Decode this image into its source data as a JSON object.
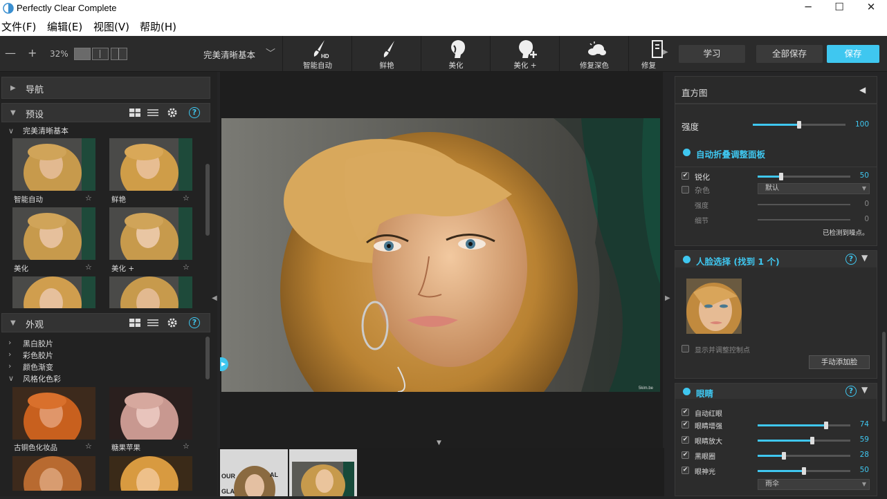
{
  "window": {
    "title": "Perfectly Clear Complete"
  },
  "menu": [
    "文件(F)",
    "编辑(E)",
    "视图(V)",
    "帮助(H)"
  ],
  "toolbar": {
    "zoom_out": "—",
    "zoom_in": "+",
    "zoom": "32%",
    "preset_selected": "完美清晰基本",
    "tools": [
      "智能自动",
      "鲜艳",
      "美化",
      "美化 +",
      "修复深色",
      "修复"
    ],
    "learn_label": "学习",
    "save_all_label": "全部保存",
    "save_label": "保存"
  },
  "left": {
    "nav_title": "导航",
    "presets_title": "预设",
    "presets_group": "完美清晰基本",
    "preset_items": [
      "智能自动",
      "鲜艳",
      "美化",
      "美化 +"
    ],
    "looks_title": "外观",
    "looks_groups": [
      "黑白胶片",
      "彩色胶片",
      "颜色渐变",
      "风格化色彩"
    ],
    "look_items": [
      "古铜色化妆品",
      "糖果苹果"
    ]
  },
  "right": {
    "histogram_title": "直方图",
    "strength_label": "强度",
    "strength_value": 100,
    "auto_collapse_label": "自动折叠调整面板",
    "sharpen_label": "锐化",
    "sharpen_value": 50,
    "noise_label": "杂色",
    "noise_select": "默认",
    "noise_strength_label": "强度",
    "noise_strength_value": 0,
    "noise_detail_label": "细节",
    "noise_detail_value": 0,
    "noise_detected": "已检测到噪点。",
    "face_title": "人脸选择 (找到 1 个)",
    "face_show_points": "显示并调整控制点",
    "face_add_manual": "手动添加脸",
    "eyes_title": "眼睛",
    "eyes_items": [
      {
        "label": "自动红眼",
        "value": null
      },
      {
        "label": "眼睛增强",
        "value": 74
      },
      {
        "label": "眼睛放大",
        "value": 59
      },
      {
        "label": "黑眼圈",
        "value": 28
      },
      {
        "label": "眼神光",
        "value": 50
      }
    ],
    "eyes_select": "雨伞"
  },
  "image": {
    "watermark": "5kim.be"
  },
  "colors": {
    "accent": "#3fc7f0",
    "panel": "#2c2c2c",
    "bg": "#1e1e1e"
  }
}
